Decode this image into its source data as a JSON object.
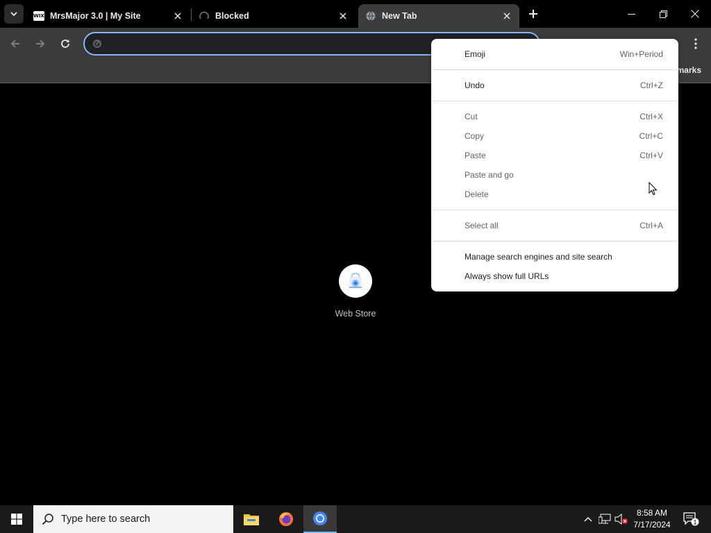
{
  "tabs": [
    {
      "title": "MrsMajor 3.0 | My Site",
      "favicon": "wix-icon",
      "favicon_text": "WIX",
      "active": false
    },
    {
      "title": "Blocked",
      "favicon": "blocked-icon",
      "active": false
    },
    {
      "title": "New Tab",
      "favicon": "globe-icon",
      "active": true
    }
  ],
  "omnibox": {
    "value": "",
    "placeholder": ""
  },
  "bookmarks": {
    "label": "marks"
  },
  "shortcuts": [
    {
      "label": "Web Store",
      "icon": "web-store-icon"
    }
  ],
  "context_menu": {
    "items": [
      {
        "label": "Emoji",
        "shortcut": "Win+Period"
      },
      {
        "label": "Undo",
        "shortcut": "Ctrl+Z"
      },
      {
        "label": "Cut",
        "shortcut": "Ctrl+X"
      },
      {
        "label": "Copy",
        "shortcut": "Ctrl+C"
      },
      {
        "label": "Paste",
        "shortcut": "Ctrl+V"
      },
      {
        "label": "Paste and go",
        "shortcut": ""
      },
      {
        "label": "Delete",
        "shortcut": ""
      },
      {
        "label": "Select all",
        "shortcut": "Ctrl+A"
      },
      {
        "label": "Manage search engines and site search",
        "shortcut": ""
      },
      {
        "label": "Always show full URLs",
        "shortcut": ""
      }
    ]
  },
  "taskbar": {
    "search_placeholder": "Type here to search",
    "apps": [
      "file-explorer-icon",
      "firefox-icon",
      "chrome-icon"
    ],
    "clock_time": "8:58 AM",
    "clock_date": "7/17/2024",
    "notification_count": "1"
  },
  "colors": {
    "focus_ring": "#8ab4f8",
    "toolbar": "#3c3c3c",
    "taskbar": "#1a1a1a",
    "active_app_indicator": "#76b9ed"
  }
}
